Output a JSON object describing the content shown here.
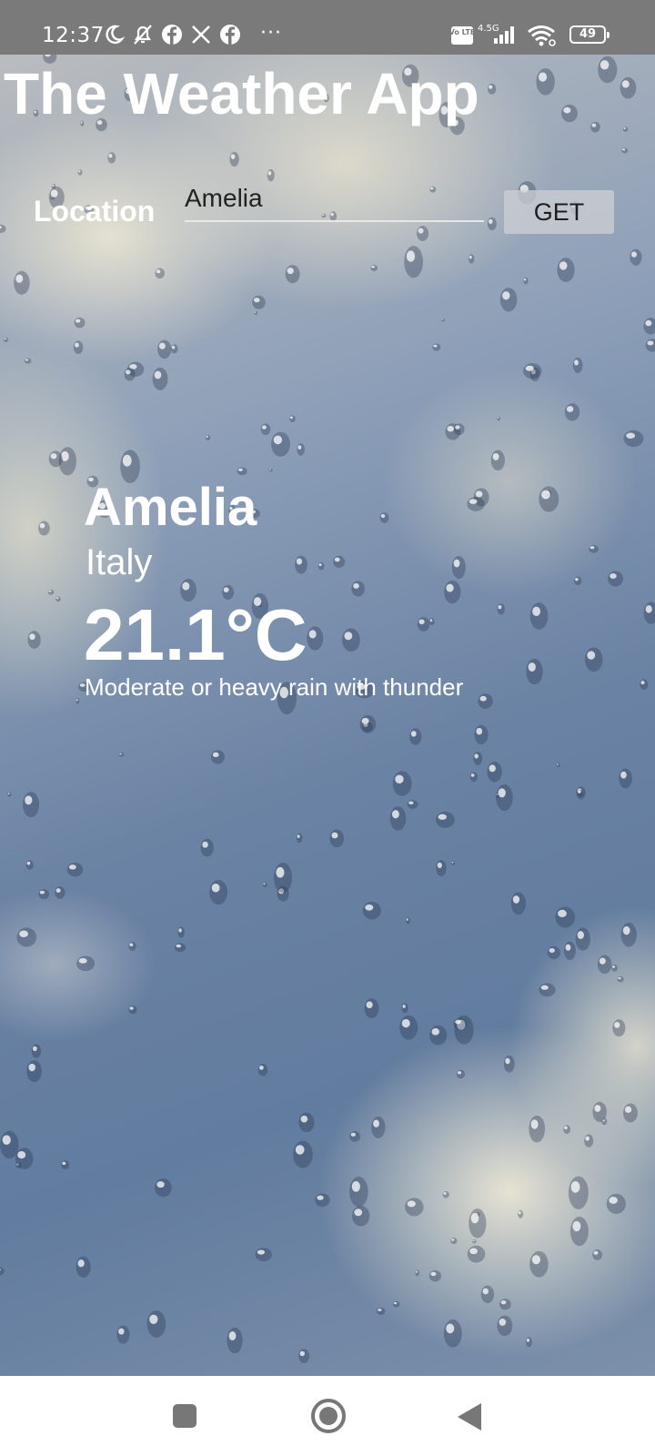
{
  "status_bar": {
    "time": "12:37",
    "network": "4.5G",
    "volte": "Vo LTE",
    "battery": "49",
    "more": "···",
    "icons": [
      "moon-icon",
      "bell-off-icon",
      "facebook-icon",
      "x-icon",
      "facebook-icon",
      "signal-icon",
      "wifi-icon",
      "battery-icon"
    ]
  },
  "app": {
    "title": "The Weather App",
    "location_label": "Location",
    "location_value": "Amelia",
    "get_label": "GET"
  },
  "weather": {
    "city": "Amelia",
    "country": "Italy",
    "temperature": "21.1°C",
    "condition": "Moderate or heavy rain with thunder"
  },
  "nav_bar": {
    "icons": [
      "recents-square-icon",
      "home-circle-icon",
      "back-triangle-icon"
    ]
  },
  "colors": {
    "status_bar_bg": "#7a7a7a",
    "text_primary": "#ffffff",
    "input_text": "#222222",
    "button_bg": "#cdd0d4",
    "nav_icon": "#777777"
  }
}
